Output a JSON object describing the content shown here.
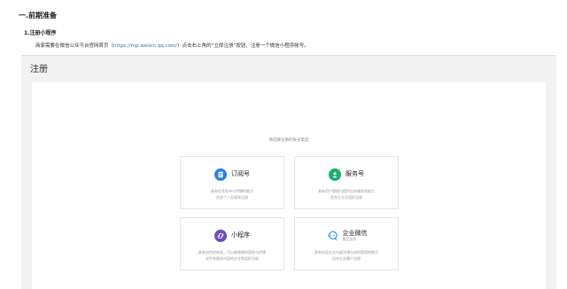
{
  "doc": {
    "heading": "一.前期准备",
    "subheading": "1.注册小程序",
    "paragraph_before": "商家需要在微信公众平台官网首页（",
    "paragraph_link": "https://mp.weixin.qq.com/",
    "paragraph_after": "）点击右上角的“立即注册”按钮，注册一个微信小程序帐号。"
  },
  "page": {
    "title": "注册",
    "hint": "请选择注册的帐号类型"
  },
  "cards": [
    {
      "title": "订阅号",
      "subtitle": "",
      "desc_lines": [
        "具有信息发布与传播的能力",
        "适合个人及媒体注册"
      ],
      "icon": "document-icon",
      "icon_color": "#2f7fe3"
    },
    {
      "title": "服务号",
      "subtitle": "",
      "desc_lines": [
        "具有用户管理与提供业务服务的能力",
        "适合企业及组织注册"
      ],
      "icon": "user-icon",
      "icon_color": "#1aad6a"
    },
    {
      "title": "小程序",
      "subtitle": "",
      "desc_lines": [
        "具有出色的体验，可以被便捷地获取与传播",
        "适合有服务内容的企业和组织注册"
      ],
      "icon": "mini-program-icon",
      "icon_color": "#6b4fbb"
    },
    {
      "title": "企业微信",
      "subtitle": "原企业号",
      "desc_lines": [
        "具有实现企业内部沟通与协同管理的能力",
        "适合企业客户注册"
      ],
      "icon": "chat-bubbles-icon",
      "icon_color": "#2f8ee8"
    }
  ]
}
